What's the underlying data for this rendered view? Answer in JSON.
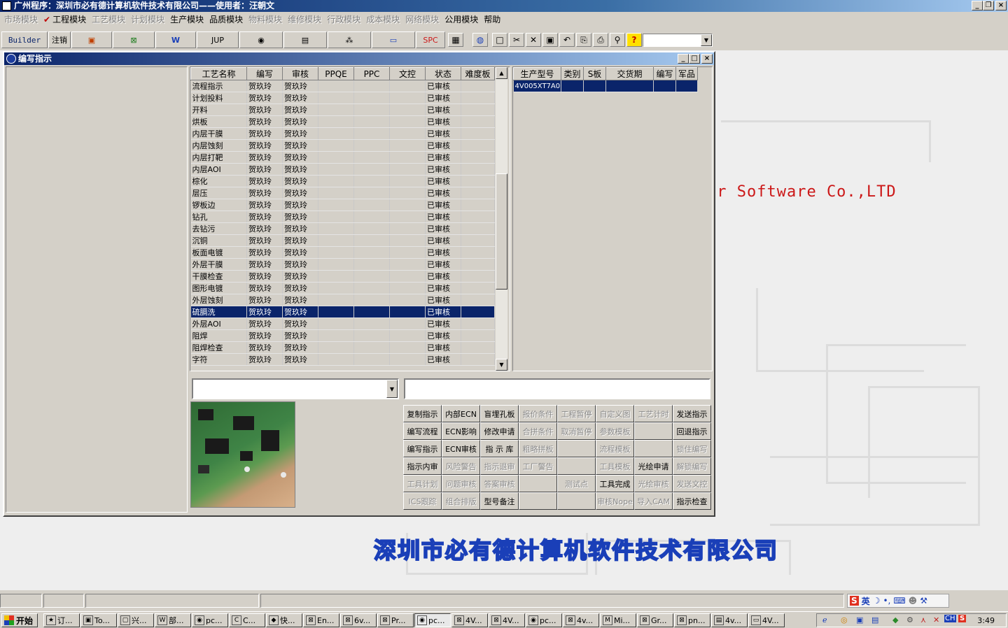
{
  "title": "广州程序：深圳市必有德计算机软件技术有限公司——使用者：汪朝文",
  "menus": [
    {
      "label": "市场模块",
      "enabled": false
    },
    {
      "label": "工程模块",
      "enabled": true,
      "checked": true
    },
    {
      "label": "工艺模块",
      "enabled": false
    },
    {
      "label": "计划模块",
      "enabled": false
    },
    {
      "label": "生产模块",
      "enabled": true
    },
    {
      "label": "品质模块",
      "enabled": true
    },
    {
      "label": "物料模块",
      "enabled": false
    },
    {
      "label": "维修模块",
      "enabled": false
    },
    {
      "label": "行政模块",
      "enabled": false
    },
    {
      "label": "成本模块",
      "enabled": false
    },
    {
      "label": "网络模块",
      "enabled": false
    },
    {
      "label": "公用模块",
      "enabled": true
    },
    {
      "label": "帮助",
      "enabled": true
    }
  ],
  "toolbar": {
    "builder": "Builder",
    "logout": "注销",
    "jup": "JUP",
    "spc": "SPC",
    "icons": [
      "powerpoint-icon",
      "excel-icon",
      "word-icon",
      "eye-icon",
      "database-icon",
      "network-icon",
      "computer-icon",
      "calendar-icon",
      "globe-icon",
      "new-doc-icon",
      "cut-icon",
      "delete-icon",
      "save-icon",
      "undo-icon",
      "preview-icon",
      "print-icon",
      "find-icon",
      "help-icon"
    ]
  },
  "child_window": {
    "title": "编写指示"
  },
  "process_grid": {
    "columns": [
      "工艺名称",
      "编写",
      "审核",
      "PPQE",
      "PPC",
      "文控",
      "状态",
      "难度板"
    ],
    "rows": [
      [
        "流程指示",
        "贺玖玲",
        "贺玖玲",
        "",
        "",
        "",
        "已审核",
        ""
      ],
      [
        "计划投料",
        "贺玖玲",
        "贺玖玲",
        "",
        "",
        "",
        "已审核",
        ""
      ],
      [
        "开料",
        "贺玖玲",
        "贺玖玲",
        "",
        "",
        "",
        "已审核",
        ""
      ],
      [
        "烘板",
        "贺玖玲",
        "贺玖玲",
        "",
        "",
        "",
        "已审核",
        ""
      ],
      [
        "内层干膜",
        "贺玖玲",
        "贺玖玲",
        "",
        "",
        "",
        "已审核",
        ""
      ],
      [
        "内层蚀刻",
        "贺玖玲",
        "贺玖玲",
        "",
        "",
        "",
        "已审核",
        ""
      ],
      [
        "内层打靶",
        "贺玖玲",
        "贺玖玲",
        "",
        "",
        "",
        "已审核",
        ""
      ],
      [
        "内层AOI",
        "贺玖玲",
        "贺玖玲",
        "",
        "",
        "",
        "已审核",
        ""
      ],
      [
        "棕化",
        "贺玖玲",
        "贺玖玲",
        "",
        "",
        "",
        "已审核",
        ""
      ],
      [
        "层压",
        "贺玖玲",
        "贺玖玲",
        "",
        "",
        "",
        "已审核",
        ""
      ],
      [
        "锣板边",
        "贺玖玲",
        "贺玖玲",
        "",
        "",
        "",
        "已审核",
        ""
      ],
      [
        "钻孔",
        "贺玖玲",
        "贺玖玲",
        "",
        "",
        "",
        "已审核",
        ""
      ],
      [
        "去钻污",
        "贺玖玲",
        "贺玖玲",
        "",
        "",
        "",
        "已审核",
        ""
      ],
      [
        "沉铜",
        "贺玖玲",
        "贺玖玲",
        "",
        "",
        "",
        "已审核",
        ""
      ],
      [
        "板面电镀",
        "贺玖玲",
        "贺玖玲",
        "",
        "",
        "",
        "已审核",
        ""
      ],
      [
        "外层干膜",
        "贺玖玲",
        "贺玖玲",
        "",
        "",
        "",
        "已审核",
        ""
      ],
      [
        "干膜检查",
        "贺玖玲",
        "贺玖玲",
        "",
        "",
        "",
        "已审核",
        ""
      ],
      [
        "图形电镀",
        "贺玖玲",
        "贺玖玲",
        "",
        "",
        "",
        "已审核",
        ""
      ],
      [
        "外层蚀刻",
        "贺玖玲",
        "贺玖玲",
        "",
        "",
        "",
        "已审核",
        ""
      ],
      [
        "硫膈洗",
        "贺玖玲",
        "贺玖玲",
        "",
        "",
        "",
        "已审核",
        ""
      ],
      [
        "外层AOI",
        "贺玖玲",
        "贺玖玲",
        "",
        "",
        "",
        "已审核",
        ""
      ],
      [
        "阻焊",
        "贺玖玲",
        "贺玖玲",
        "",
        "",
        "",
        "已审核",
        ""
      ],
      [
        "阻焊检查",
        "贺玖玲",
        "贺玖玲",
        "",
        "",
        "",
        "已审核",
        ""
      ],
      [
        "字符",
        "贺玖玲",
        "贺玖玲",
        "",
        "",
        "",
        "已审核",
        ""
      ]
    ],
    "selected_index": 19
  },
  "product_grid": {
    "columns": [
      "生产型号",
      "类别",
      "S板",
      "交货期",
      "编写",
      "军品"
    ],
    "rows": [
      [
        "4V005XT7A0",
        "",
        "",
        "",
        "",
        ""
      ]
    ],
    "selected_index": 0
  },
  "combo_value": "",
  "text_value": "",
  "buttons": [
    [
      {
        "label": "复制指示",
        "enabled": true
      },
      {
        "label": "内部ECN",
        "enabled": true
      },
      {
        "label": "盲埋孔板",
        "enabled": true
      },
      {
        "label": "报价条件",
        "enabled": false
      },
      {
        "label": "工程暂停",
        "enabled": false
      },
      {
        "label": "自定义图",
        "enabled": false
      },
      {
        "label": "工艺计时",
        "enabled": false
      },
      {
        "label": "发送指示",
        "enabled": true
      }
    ],
    [
      {
        "label": "编写流程",
        "enabled": true
      },
      {
        "label": "ECN影响",
        "enabled": true
      },
      {
        "label": "修改申请",
        "enabled": true
      },
      {
        "label": "合拼条件",
        "enabled": false
      },
      {
        "label": "取消暂停",
        "enabled": false
      },
      {
        "label": "参数模板",
        "enabled": false
      },
      {
        "label": "",
        "enabled": false
      },
      {
        "label": "回退指示",
        "enabled": true
      }
    ],
    [
      {
        "label": "编写指示",
        "enabled": true
      },
      {
        "label": "ECN审核",
        "enabled": true
      },
      {
        "label": "指 示 库",
        "enabled": true
      },
      {
        "label": "粗略拼板",
        "enabled": false
      },
      {
        "label": "",
        "enabled": false
      },
      {
        "label": "流程模板",
        "enabled": false
      },
      {
        "label": "",
        "enabled": false
      },
      {
        "label": "锁住编写",
        "enabled": false
      }
    ],
    [
      {
        "label": "指示内审",
        "enabled": true
      },
      {
        "label": "风险警告",
        "enabled": false
      },
      {
        "label": "指示退审",
        "enabled": false
      },
      {
        "label": "工厂警告",
        "enabled": false
      },
      {
        "label": "",
        "enabled": false
      },
      {
        "label": "工具模板",
        "enabled": false
      },
      {
        "label": "光绘申请",
        "enabled": true
      },
      {
        "label": "解锁编写",
        "enabled": false
      }
    ],
    [
      {
        "label": "工具计划",
        "enabled": false
      },
      {
        "label": "问题审核",
        "enabled": false
      },
      {
        "label": "答案审核",
        "enabled": false
      },
      {
        "label": "",
        "enabled": false
      },
      {
        "label": "测试点",
        "enabled": false
      },
      {
        "label": "工具完成",
        "enabled": true
      },
      {
        "label": "光绘审核",
        "enabled": false
      },
      {
        "label": "发送文控",
        "enabled": false
      }
    ],
    [
      {
        "label": "ICS跟踪",
        "enabled": false
      },
      {
        "label": "组合排版",
        "enabled": false
      },
      {
        "label": "型号备注",
        "enabled": true
      },
      {
        "label": "",
        "enabled": false
      },
      {
        "label": "",
        "enabled": false
      },
      {
        "label": "审核Nope",
        "enabled": false
      },
      {
        "label": "导入CAM",
        "enabled": false
      },
      {
        "label": "指示检查",
        "enabled": true
      }
    ]
  ],
  "background": {
    "slogan": "er Software Co.,LTD",
    "company": "深圳市必有德计算机软件技术有限公司"
  },
  "ime": {
    "lang": "英"
  },
  "taskbar": {
    "start": "开始",
    "tasks": [
      "订...",
      "To...",
      "兴...",
      "部...",
      "pc...",
      "C...",
      "快...",
      "En...",
      "6v...",
      "Pr...",
      "pc...",
      "4V...",
      "4V...",
      "pc...",
      "4v...",
      "Mi...",
      "Gr...",
      "pn...",
      "4v...",
      "4V..."
    ],
    "active_task": 10,
    "clock": "3:49"
  },
  "colors": {
    "selection": "#0a246a",
    "title_gradient_start": "#0a246a",
    "slogan": "#cc1818",
    "company_stroke": "#1a3fb8"
  }
}
